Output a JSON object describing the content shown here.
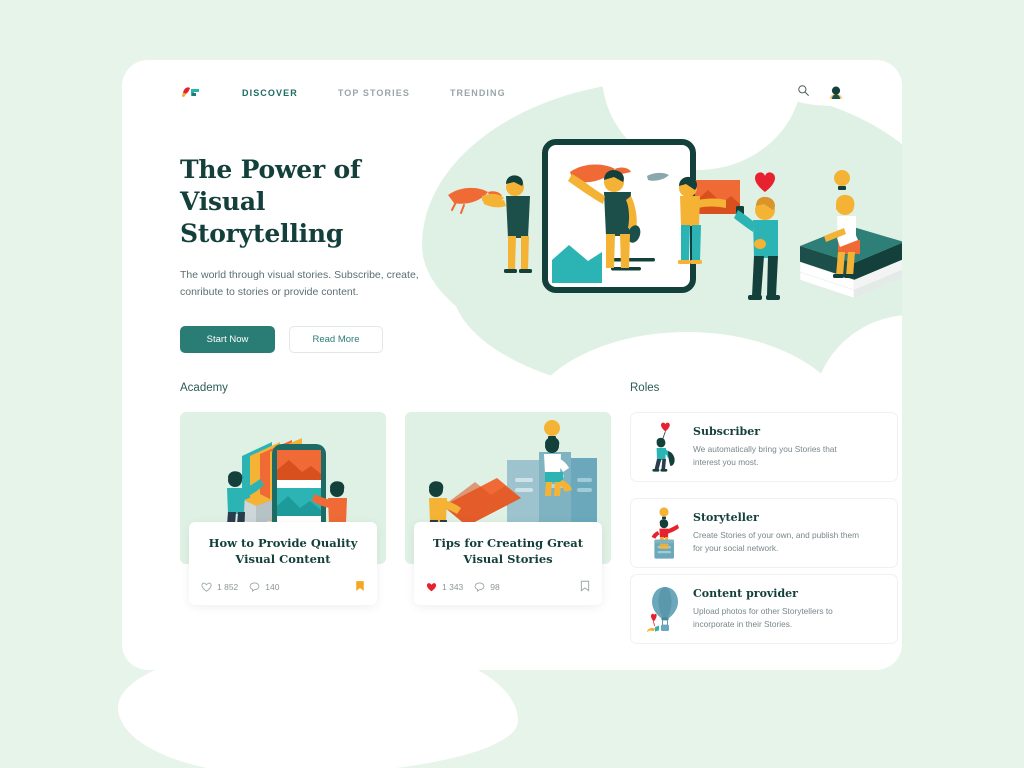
{
  "brand": {
    "logo_name": "visual-storytelling-logo"
  },
  "nav": {
    "items": [
      {
        "label": "DISCOVER",
        "active": true
      },
      {
        "label": "TOP STORIES",
        "active": false
      },
      {
        "label": "TRENDING",
        "active": false
      }
    ]
  },
  "header_actions": {
    "search_icon": "search-icon",
    "avatar": "user-avatar"
  },
  "hero": {
    "title_line1": "The Power of Visual",
    "title_line2": "Storytelling",
    "subtitle": "The world through visual stories. Subscribe, create, conribute to stories or provide content.",
    "primary_button": "Start Now",
    "secondary_button": "Read More",
    "illustration": "visual-storytelling-illustration"
  },
  "academy": {
    "label": "Academy",
    "articles": [
      {
        "title_line1": "How to Provide Quality",
        "title_line2": "Visual Content",
        "likes": "1 852",
        "comments": "140",
        "liked": false,
        "bookmarked": true,
        "illustration": "phone-photo-gallery-illustration"
      },
      {
        "title_line1": "Tips for Creating Great",
        "title_line2": "Visual Stories",
        "likes": "1 343",
        "comments": "98",
        "liked": true,
        "bookmarked": false,
        "illustration": "photo-columns-idea-illustration"
      }
    ]
  },
  "roles": {
    "label": "Roles",
    "items": [
      {
        "title": "Subscriber",
        "desc": "We automatically bring you Stories that interest you most.",
        "icon": "person-with-heart-balloon-icon"
      },
      {
        "title": "Storyteller",
        "desc": "Create Stories of your own, and publish them for your social network.",
        "icon": "person-on-pedestal-idea-icon"
      },
      {
        "title": "Content provider",
        "desc": "Upload photos for other Storytellers to incorporate in their Stories.",
        "icon": "hot-air-balloon-icon"
      }
    ]
  },
  "colors": {
    "page_background": "#e7f4ea",
    "panel_background": "#ffffff",
    "accent_teal": "#2a7d75",
    "dark_teal": "#14403c",
    "mint": "#dff1e4",
    "orange": "#ef6a35",
    "yellow": "#f5b335",
    "red_heart": "#e8212f",
    "bookmark_orange": "#f5a623",
    "muted_text": "#79878a"
  }
}
